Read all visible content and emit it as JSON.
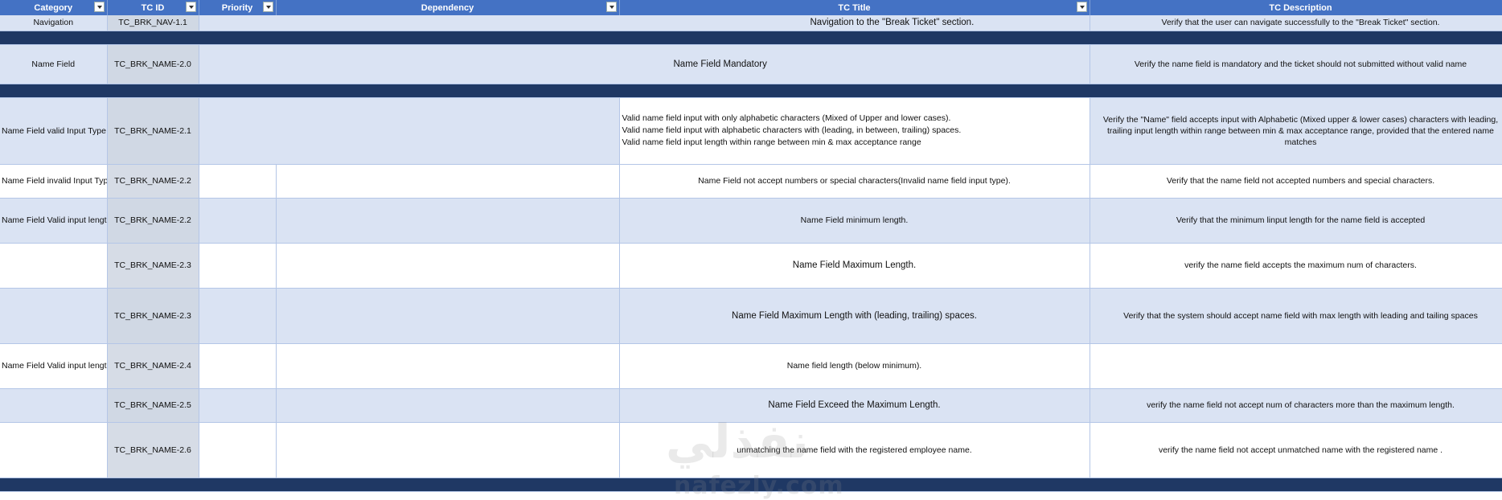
{
  "headers": {
    "category": "Category",
    "tc_id": "TC ID",
    "priority": "Priority",
    "dependency": "Dependency",
    "tc_title": "TC  Title",
    "tc_description": "TC Description"
  },
  "rows": [
    {
      "category": "Navigation",
      "id": "TC_BRK_NAV-1.1",
      "title": "Navigation to the \"Break Ticket\" section.",
      "desc": "Verify that the user can navigate successfully to the \"Break Ticket\" section."
    },
    {
      "category": "Name Field",
      "id": "TC_BRK_NAME-2.0",
      "title": "Name Field Mandatory",
      "desc": "Verify the name field is mandatory and the ticket should not submitted without valid name"
    },
    {
      "category": "Name Field valid Input Type",
      "id": "TC_BRK_NAME-2.1",
      "dep_lines": [
        "Valid name field input with only alphabetic characters (Mixed of Upper and lower cases).",
        "Valid name field input with alphabetic characters with (leading, in between, trailing) spaces.",
        "Valid name field input length within range between min & max acceptance range"
      ],
      "desc": "Verify the \"Name\" field accepts input with Alphabetic (Mixed upper & lower cases) characters with leading, trailing input length within range between min & max acceptance range, provided that the entered name matches"
    },
    {
      "category": "Name Field invalid Input Type",
      "id": "TC_BRK_NAME-2.2",
      "title": "Name Field not accept numbers or special characters(Invalid name field input type).",
      "desc": "Verify that the name field not accepted numbers and special characters."
    },
    {
      "category": "Name Field Valid input length",
      "id": "TC_BRK_NAME-2.2",
      "title": "Name Field minimum length.",
      "desc": "Verify that the minimum linput length for the name field is accepted"
    },
    {
      "category": "",
      "id": "TC_BRK_NAME-2.3",
      "title": "Name Field Maximum Length.",
      "desc": "verify the name field accepts the maximum num of characters."
    },
    {
      "category": "",
      "id": "TC_BRK_NAME-2.3",
      "title": "Name Field Maximum Length with (leading,  trailing) spaces.",
      "desc": "Verify that the system should accept name field with max length with leading and tailing spaces"
    },
    {
      "category": "Name Field Valid input length",
      "id": "TC_BRK_NAME-2.4",
      "title": "Name field length (below minimum).",
      "desc": ""
    },
    {
      "category": "",
      "id": "TC_BRK_NAME-2.5",
      "title": "Name Field Exceed the Maximum Length.",
      "desc": "verify the name field not accept num of characters more than the maximum length."
    },
    {
      "category": "",
      "id": "TC_BRK_NAME-2.6",
      "title": "unmatching the name field with the registered employee name.",
      "desc": "verify the name field not accept unmatched name with the registered name ."
    }
  ],
  "watermark": {
    "arabic": "نفذلي",
    "latin": "nafezly.com"
  }
}
